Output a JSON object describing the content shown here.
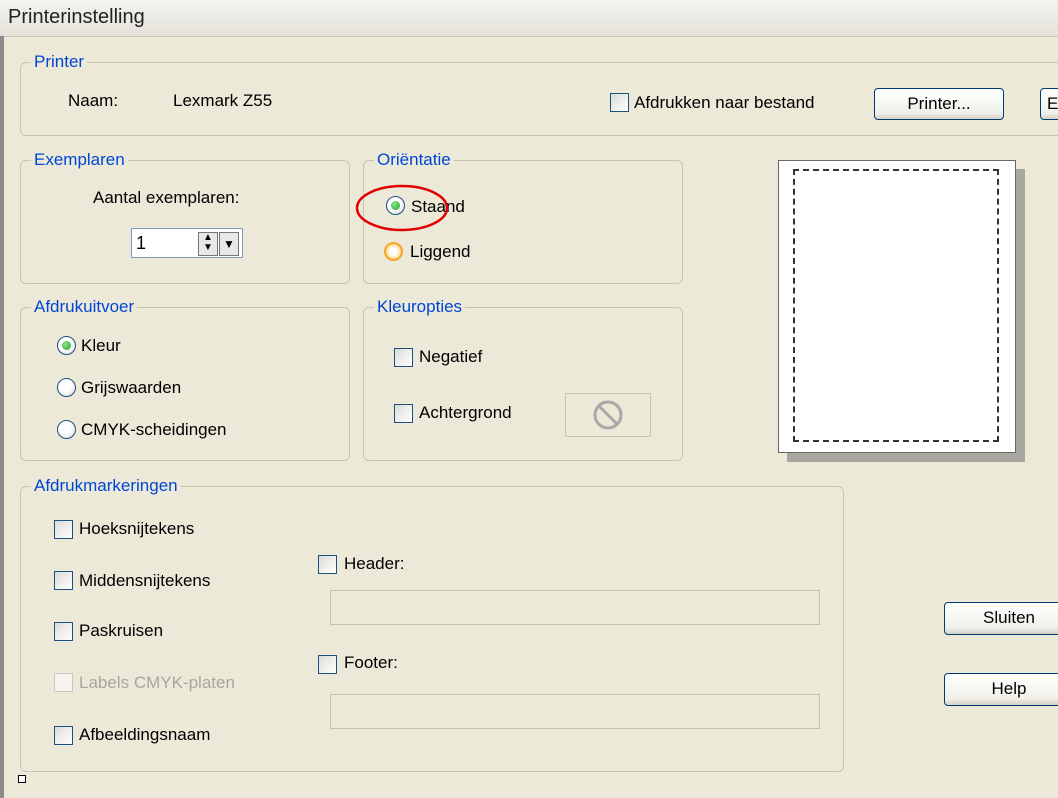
{
  "window": {
    "title": "Printerinstelling"
  },
  "printer": {
    "legend": "Printer",
    "name_label": "Naam:",
    "name_value": "Lexmark Z55",
    "print_to_file_label": "Afdrukken naar bestand",
    "printer_button": "Printer...",
    "cutoff_button": "E"
  },
  "exemplaren": {
    "legend": "Exemplaren",
    "count_label": "Aantal exemplaren:",
    "count_value": "1"
  },
  "orientatie": {
    "legend": "Oriëntatie",
    "staand": "Staand",
    "liggend": "Liggend",
    "selected": "staand"
  },
  "afdrukuitvoer": {
    "legend": "Afdrukuitvoer",
    "kleur": "Kleur",
    "grijswaarden": "Grijswaarden",
    "cmyk": "CMYK-scheidingen",
    "selected": "kleur"
  },
  "kleuropties": {
    "legend": "Kleuropties",
    "negatief": "Negatief",
    "achtergrond": "Achtergrond",
    "none_icon": "prohibited-icon"
  },
  "afdrukmarkeringen": {
    "legend": "Afdrukmarkeringen",
    "hoeksnijtekens": "Hoeksnijtekens",
    "middensnijtekens": "Middensnijtekens",
    "paskruisen": "Paskruisen",
    "labels_cmyk": "Labels CMYK-platen",
    "afbeeldingsnaam": "Afbeeldingsnaam",
    "header": "Header:",
    "footer": "Footer:",
    "header_value": "",
    "footer_value": ""
  },
  "actions": {
    "sluiten": "Sluiten",
    "help": "Help"
  },
  "colors": {
    "legend_text": "#0046d5",
    "annotation_circle": "#e00000",
    "dialog_bg": "#ece9d8"
  }
}
